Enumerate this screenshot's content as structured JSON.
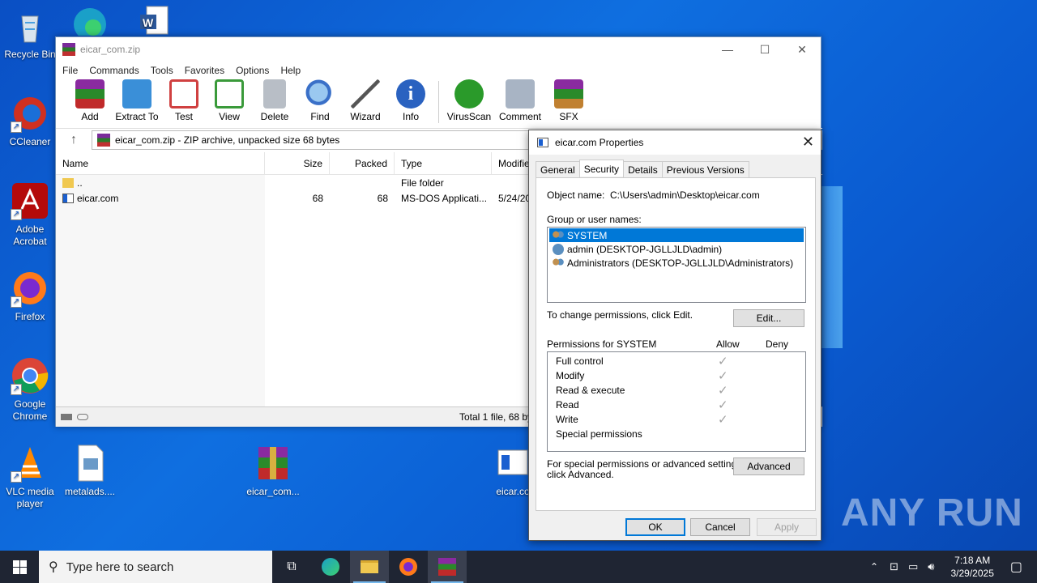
{
  "desktop": {
    "icons": [
      {
        "label": "Recycle Bin",
        "icon": "recycle-bin-icon"
      },
      {
        "label": "CCleaner",
        "icon": "ccleaner-icon"
      },
      {
        "label": "Adobe Acrobat",
        "icon": "acrobat-icon"
      },
      {
        "label": "Firefox",
        "icon": "firefox-icon"
      },
      {
        "label": "Google Chrome",
        "icon": "chrome-icon"
      },
      {
        "label": "VLC media player",
        "icon": "vlc-icon"
      },
      {
        "label": "metalads....",
        "icon": "image-file-icon"
      },
      {
        "label": "eicar_com...",
        "icon": "winrar-archive-icon"
      },
      {
        "label": "eicar.co",
        "icon": "com-file-icon"
      }
    ],
    "watermark": "ANY RUN"
  },
  "winrar": {
    "title": "eicar_com.zip",
    "menu": [
      "File",
      "Commands",
      "Tools",
      "Favorites",
      "Options",
      "Help"
    ],
    "toolbar": [
      {
        "label": "Add",
        "icon": "add-archive-icon",
        "color": "#b04040"
      },
      {
        "label": "Extract To",
        "icon": "extract-folder-icon",
        "color": "#3a8fd8"
      },
      {
        "label": "Test",
        "icon": "test-clipboard-icon",
        "color": "#d04040"
      },
      {
        "label": "View",
        "icon": "view-book-icon",
        "color": "#3a9a3a"
      },
      {
        "label": "Delete",
        "icon": "trash-icon",
        "color": "#9aa0a8"
      },
      {
        "label": "Find",
        "icon": "magnifier-icon",
        "color": "#3a70c8"
      },
      {
        "label": "Wizard",
        "icon": "wizard-wand-icon",
        "color": "#8a8a8a"
      },
      {
        "label": "Info",
        "icon": "info-icon",
        "color": "#2a62c0"
      },
      {
        "label": "VirusScan",
        "icon": "virus-scan-icon",
        "color": "#2a9a2a"
      },
      {
        "label": "Comment",
        "icon": "comment-icon",
        "color": "#7a8aa0"
      },
      {
        "label": "SFX",
        "icon": "sfx-box-icon",
        "color": "#c08030"
      }
    ],
    "path": "eicar_com.zip - ZIP archive, unpacked size 68 bytes",
    "columns": {
      "name": "Name",
      "size": "Size",
      "packed": "Packed",
      "type": "Type",
      "modified": "Modifie"
    },
    "rows": [
      {
        "name": "..",
        "size": "",
        "packed": "",
        "type": "File folder",
        "modified": ""
      },
      {
        "name": "eicar.com",
        "size": "68",
        "packed": "68",
        "type": "MS-DOS Applicati...",
        "modified": "5/24/20"
      }
    ],
    "status": "Total 1 file, 68 by"
  },
  "dialog": {
    "title": "eicar.com Properties",
    "tabs": [
      "General",
      "Security",
      "Details",
      "Previous Versions"
    ],
    "object_name_label": "Object name:",
    "object_name": "C:\\Users\\admin\\Desktop\\eicar.com",
    "group_label": "Group or user names:",
    "users": [
      "SYSTEM",
      "admin (DESKTOP-JGLLJLD\\admin)",
      "Administrators (DESKTOP-JGLLJLD\\Administrators)"
    ],
    "change_text": "To change permissions, click Edit.",
    "edit_button": "Edit...",
    "perm_label": "Permissions for SYSTEM",
    "allow_label": "Allow",
    "deny_label": "Deny",
    "permissions": [
      "Full control",
      "Modify",
      "Read & execute",
      "Read",
      "Write",
      "Special permissions"
    ],
    "allowed": [
      true,
      true,
      true,
      true,
      true,
      false
    ],
    "special_text_1": "For special permissions or advanced settings,",
    "special_text_2": "click Advanced.",
    "advanced_button": "Advanced",
    "ok": "OK",
    "cancel": "Cancel",
    "apply": "Apply"
  },
  "taskbar": {
    "search_placeholder": "Type here to search",
    "time": "7:18 AM",
    "date": "3/29/2025"
  }
}
